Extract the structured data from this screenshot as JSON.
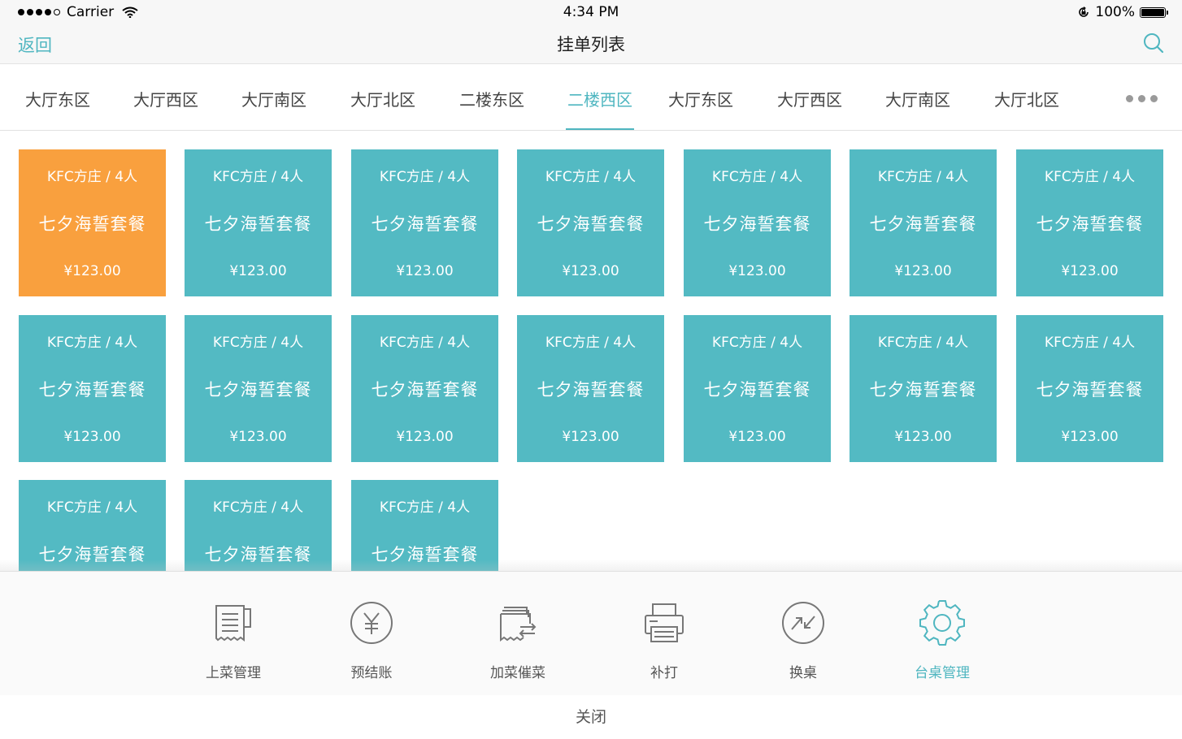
{
  "status_bar": {
    "carrier": "Carrier",
    "time": "4:34 PM",
    "battery": "100%"
  },
  "nav": {
    "back_label": "返回",
    "title": "挂单列表"
  },
  "tabs": [
    {
      "label": "大厅东区"
    },
    {
      "label": "大厅西区"
    },
    {
      "label": "大厅南区"
    },
    {
      "label": "大厅北区"
    },
    {
      "label": "二楼东区"
    },
    {
      "label": "二楼西区"
    },
    {
      "label": "大厅东区"
    },
    {
      "label": "大厅西区"
    },
    {
      "label": "大厅南区"
    },
    {
      "label": "大厅北区"
    }
  ],
  "active_tab": "二楼西区",
  "orders": [
    {
      "title": "KFC方庄 / 4人",
      "name": "七夕海誓套餐",
      "price": "¥123.00",
      "highlighted": true
    },
    {
      "title": "KFC方庄 / 4人",
      "name": "七夕海誓套餐",
      "price": "¥123.00"
    },
    {
      "title": "KFC方庄 / 4人",
      "name": "七夕海誓套餐",
      "price": "¥123.00"
    },
    {
      "title": "KFC方庄 / 4人",
      "name": "七夕海誓套餐",
      "price": "¥123.00"
    },
    {
      "title": "KFC方庄 / 4人",
      "name": "七夕海誓套餐",
      "price": "¥123.00"
    },
    {
      "title": "KFC方庄 / 4人",
      "name": "七夕海誓套餐",
      "price": "¥123.00"
    },
    {
      "title": "KFC方庄 / 4人",
      "name": "七夕海誓套餐",
      "price": "¥123.00"
    },
    {
      "title": "KFC方庄 / 4人",
      "name": "七夕海誓套餐",
      "price": "¥123.00"
    },
    {
      "title": "KFC方庄 / 4人",
      "name": "七夕海誓套餐",
      "price": "¥123.00"
    },
    {
      "title": "KFC方庄 / 4人",
      "name": "七夕海誓套餐",
      "price": "¥123.00"
    },
    {
      "title": "KFC方庄 / 4人",
      "name": "七夕海誓套餐",
      "price": "¥123.00"
    },
    {
      "title": "KFC方庄 / 4人",
      "name": "七夕海誓套餐",
      "price": "¥123.00"
    },
    {
      "title": "KFC方庄 / 4人",
      "name": "七夕海誓套餐",
      "price": "¥123.00"
    },
    {
      "title": "KFC方庄 / 4人",
      "name": "七夕海誓套餐",
      "price": "¥123.00"
    },
    {
      "title": "KFC方庄 / 4人",
      "name": "七夕海誓套餐"
    },
    {
      "title": "KFC方庄 / 4人",
      "name": "七夕海誓套餐"
    },
    {
      "title": "KFC方庄 / 4人",
      "name": "七夕海誓套餐"
    }
  ],
  "actions": [
    {
      "label": "上菜管理",
      "icon": "serve-list-icon"
    },
    {
      "label": "预结账",
      "icon": "yuan-coin-icon"
    },
    {
      "label": "加菜催菜",
      "icon": "add-dish-icon"
    },
    {
      "label": "补打",
      "icon": "printer-icon"
    },
    {
      "label": "换桌",
      "icon": "swap-table-icon"
    },
    {
      "label": "台桌管理",
      "icon": "gear-icon",
      "active": true
    }
  ],
  "close_label": "关闭",
  "colors": {
    "accent": "#4fb6c0",
    "card": "#53bac3",
    "card_active": "#f9a03e"
  }
}
